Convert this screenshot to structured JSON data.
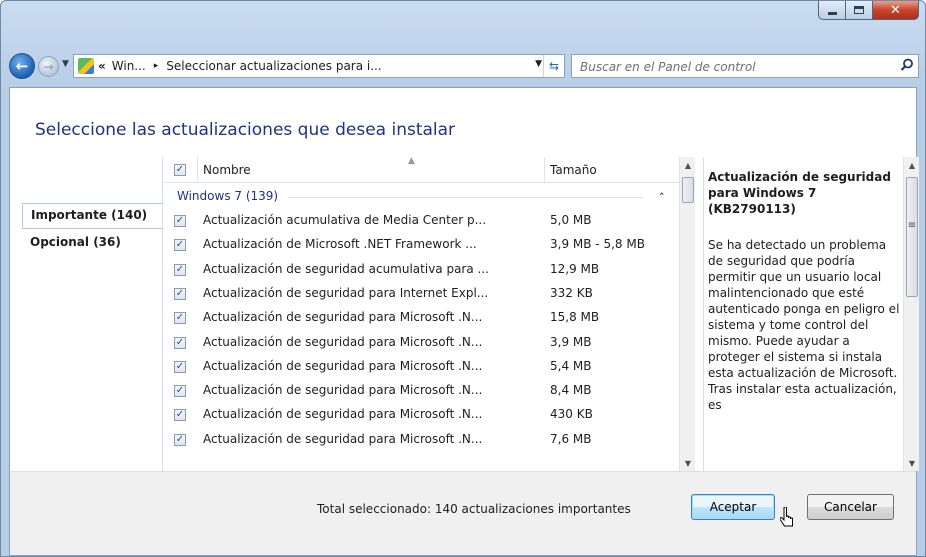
{
  "window": {
    "controls": {
      "minimize_icon": "minimize-icon",
      "maximize_icon": "maximize-icon",
      "close_icon": "close-icon"
    }
  },
  "nav": {
    "back_icon": "arrow-left",
    "forward_icon": "arrow-right",
    "address": {
      "overflow": "«",
      "crumbs": [
        "Win...",
        "Seleccionar actualizaciones para i..."
      ],
      "separator": "▸"
    },
    "search": {
      "placeholder": "Buscar en el Panel de control"
    }
  },
  "page": {
    "title": "Seleccione las actualizaciones que desea instalar",
    "categories": [
      {
        "label": "Importante (140)",
        "selected": true
      },
      {
        "label": "Opcional (36)",
        "selected": false
      }
    ],
    "list": {
      "columns": {
        "name": "Nombre",
        "size": "Tamaño"
      },
      "header_checked": true,
      "group": {
        "label": "Windows 7 (139)",
        "expanded": true
      },
      "rows": [
        {
          "checked": true,
          "name": "Actualización acumulativa de Media Center p...",
          "size": "5,0 MB"
        },
        {
          "checked": true,
          "name": "Actualización de Microsoft .NET Framework ...",
          "size": "3,9 MB - 5,8 MB"
        },
        {
          "checked": true,
          "name": "Actualización de seguridad acumulativa para ...",
          "size": "12,9 MB"
        },
        {
          "checked": true,
          "name": "Actualización de seguridad para Internet Expl...",
          "size": "332 KB"
        },
        {
          "checked": true,
          "name": "Actualización de seguridad para Microsoft .N...",
          "size": "15,8 MB"
        },
        {
          "checked": true,
          "name": "Actualización de seguridad para Microsoft .N...",
          "size": "3,9 MB"
        },
        {
          "checked": true,
          "name": "Actualización de seguridad para Microsoft .N...",
          "size": "5,4 MB"
        },
        {
          "checked": true,
          "name": "Actualización de seguridad para Microsoft .N...",
          "size": "8,4 MB"
        },
        {
          "checked": true,
          "name": "Actualización de seguridad para Microsoft .N...",
          "size": "430 KB"
        },
        {
          "checked": true,
          "name": "Actualización de seguridad para Microsoft .N...",
          "size": "7,6 MB"
        }
      ]
    },
    "details": {
      "title": "Actualización de seguridad para Windows 7 (KB2790113)",
      "body": "Se ha detectado un problema de seguridad que podría permitir que un usuario local malintencionado que esté autenticado ponga en peligro el sistema y tome control del mismo. Puede ayudar a proteger el sistema si instala esta actualización de Microsoft. Tras instalar esta actualización, es"
    }
  },
  "footer": {
    "total": "Total seleccionado: 140 actualizaciones importantes",
    "ok_label": "Aceptar",
    "cancel_label": "Cancelar"
  },
  "colors": {
    "title_blue": "#1e3287",
    "frame": "#b7cde6",
    "accent": "#3c7fb1"
  }
}
